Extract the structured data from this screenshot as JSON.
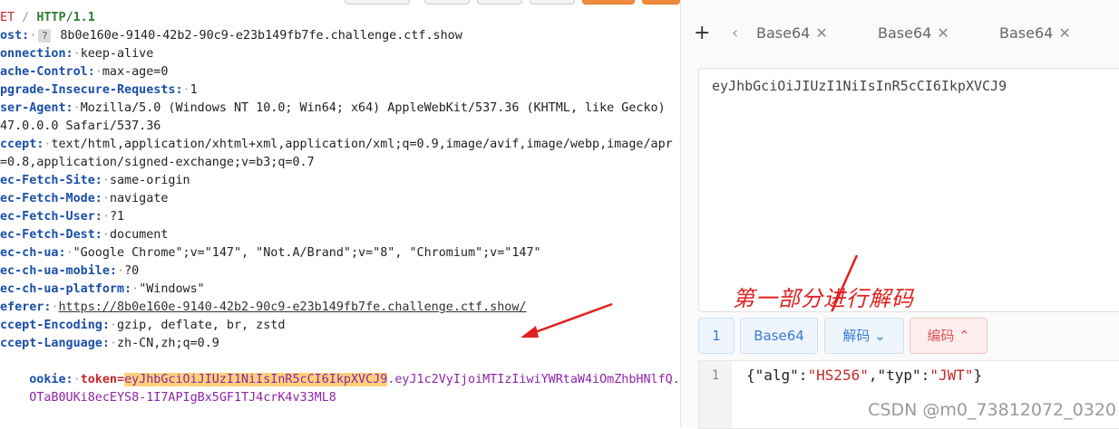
{
  "request": {
    "lines": [
      {
        "k": "ET",
        "sep": " / ",
        "v": "HTTP/1.1",
        "kind": "method"
      },
      {
        "k": "ost:",
        "badge": "?",
        "v": "8b0e160e-9140-42b2-90c9-e23b149fb7fe.challenge.ctf.show"
      },
      {
        "k": "onnection:",
        "v": "keep-alive"
      },
      {
        "k": "ache-Control:",
        "v": "max-age=0"
      },
      {
        "k": "pgrade-Insecure-Requests:",
        "v": "1"
      },
      {
        "k": "ser-Agent:",
        "v": "Mozilla/5.0 (Windows NT 10.0; Win64; x64) AppleWebKit/537.36 (KHTML, like Gecko)"
      },
      {
        "k": "",
        "v": "47.0.0.0 Safari/537.36"
      },
      {
        "k": "ccept:",
        "v": "text/html,application/xhtml+xml,application/xml;q=0.9,image/avif,image/webp,image/apr"
      },
      {
        "k": "",
        "v": "=0.8,application/signed-exchange;v=b3;q=0.7"
      },
      {
        "k": "ec-Fetch-Site:",
        "v": "same-origin"
      },
      {
        "k": "ec-Fetch-Mode:",
        "v": "navigate"
      },
      {
        "k": "ec-Fetch-User:",
        "v": "?1"
      },
      {
        "k": "ec-Fetch-Dest:",
        "v": "document"
      },
      {
        "k": "ec-ch-ua:",
        "v": "\"Google Chrome\";v=\"147\", \"Not.A/Brand\";v=\"8\", \"Chromium\";v=\"147\""
      },
      {
        "k": "ec-ch-ua-mobile:",
        "v": "?0"
      },
      {
        "k": "ec-ch-ua-platform:",
        "v": "\"Windows\""
      },
      {
        "k": "eferer:",
        "v": "https://8b0e160e-9140-42b2-90c9-e23b149fb7fe.challenge.ctf.show/",
        "kind": "url"
      },
      {
        "k": "ccept-Encoding:",
        "v": "gzip, deflate, br, zstd"
      },
      {
        "k": "ccept-Language:",
        "v": "zh-CN,zh;q=0.9"
      }
    ],
    "cookie_key": "ookie:",
    "cookie_name": "token=",
    "cookie_header": "eyJhbGciOiJIUzI1NiIsInR5cCI6IkpXVCJ9",
    "cookie_rest": ".eyJ1c2VyIjoiMTIzIiwiYWRtaW4iOmZhbHNlfQ.",
    "cookie_sig": "OTaB0UKi8ecEYS8-1I7APIgBx5GF1TJ4crK4v33ML8"
  },
  "decoder": {
    "tabs": [
      {
        "label": "Base64"
      },
      {
        "label": "Base64"
      },
      {
        "label": "Base64"
      }
    ],
    "input_text": "eyJhbGciOiJIUzI1NiIsInR5cCI6IkpXVCJ9",
    "annotation": "第一部分进行解码",
    "buttons": {
      "index": "1",
      "type": "Base64",
      "decode": "解码",
      "encode": "编码"
    },
    "output_line_no": "1",
    "output": {
      "p1": "{\"alg\":",
      "s1": "\"HS256\"",
      "p2": ",\"typ\":",
      "s2": "\"JWT\"",
      "p3": "}"
    }
  },
  "watermark": "CSDN @m0_73812072_0320",
  "colors": {
    "accent": "#3a7bd5",
    "annotation": "#e02020",
    "highlight": "#ffd27a"
  }
}
